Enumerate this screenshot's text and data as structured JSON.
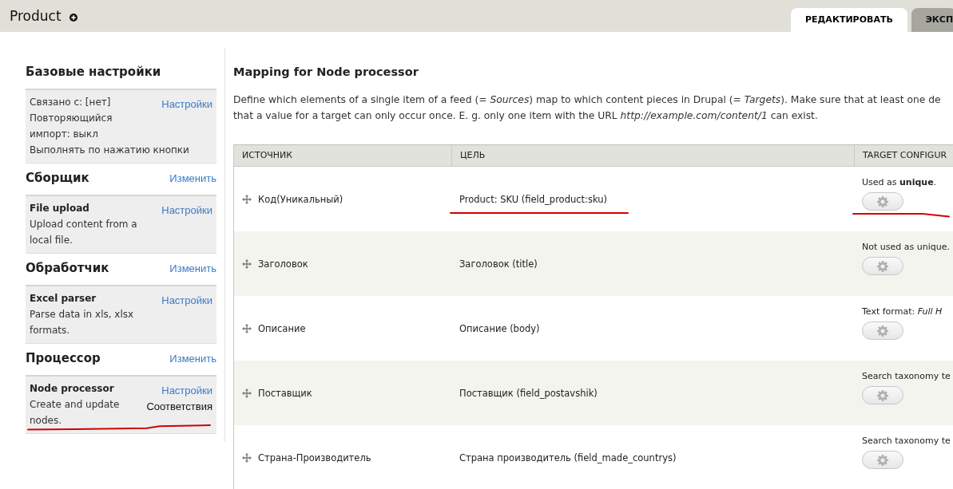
{
  "header": {
    "title": "Product",
    "tabs": [
      {
        "label": "РЕДАКТИРОВАТЬ",
        "selected": true
      },
      {
        "label": "ЭКСП",
        "selected": false
      }
    ]
  },
  "sidebar": {
    "sections": [
      {
        "title": "Базовые настройки",
        "annotated": false,
        "plugin": {
          "lines": [
            "Связано с: [нет]",
            "Повторяющийся импорт: выкл",
            "Выполнять по нажатию кнопки"
          ],
          "links": [
            {
              "label": "Настройки",
              "kind": "link"
            }
          ]
        }
      },
      {
        "title": "Сборщик",
        "change_link": "Изменить",
        "annotated": false,
        "plugin": {
          "name": "File upload",
          "lines": [
            "Upload content from a local file."
          ],
          "links": [
            {
              "label": "Настройки",
              "kind": "link"
            }
          ]
        }
      },
      {
        "title": "Обработчик",
        "change_link": "Изменить",
        "annotated": false,
        "plugin": {
          "name": "Excel parser",
          "lines": [
            "Parse data in xls, xlsx formats."
          ],
          "links": [
            {
              "label": "Настройки",
              "kind": "link"
            }
          ]
        }
      },
      {
        "title": "Процессор",
        "change_link": "Изменить",
        "annotated": true,
        "plugin": {
          "name": "Node processor",
          "lines": [
            "Create and update nodes."
          ],
          "links": [
            {
              "label": "Настройки",
              "kind": "link"
            },
            {
              "label": "Соответствия",
              "kind": "plain"
            }
          ]
        }
      }
    ]
  },
  "main": {
    "title": "Mapping for Node processor",
    "description_lines": [
      "Define which elements of a single item of a feed (= *Sources*) map to which content pieces in Drupal (= *Targets*). Make sure that at least one de",
      "that a value for a target can only occur once. E. g. only one item with the URL *http://example.com/content/1* can exist."
    ],
    "table": {
      "columns": [
        "ИСТОЧНИК",
        "ЦЕЛЬ",
        "TARGET CONFIGUR"
      ],
      "rows": [
        {
          "source": "Код(Уникальный)",
          "target": "Product: SKU (field_product:sku)",
          "configuration": "Used as **unique**.",
          "annotated": true
        },
        {
          "source": "Заголовок",
          "target": "Заголовок (title)",
          "configuration": "Not used as unique.",
          "annotated": false
        },
        {
          "source": "Описание",
          "target": "Описание (body)",
          "configuration": "Text format: *Full H*",
          "annotated": false
        },
        {
          "source": "Поставщик",
          "target": "Поставщик (field_postavshik)",
          "configuration": "Search taxonomy te",
          "annotated": false
        },
        {
          "source": "Страна-Производитель",
          "target": "Страна производитель (field_made_countrys)",
          "configuration": "Search taxonomy te",
          "annotated": false
        }
      ]
    }
  }
}
